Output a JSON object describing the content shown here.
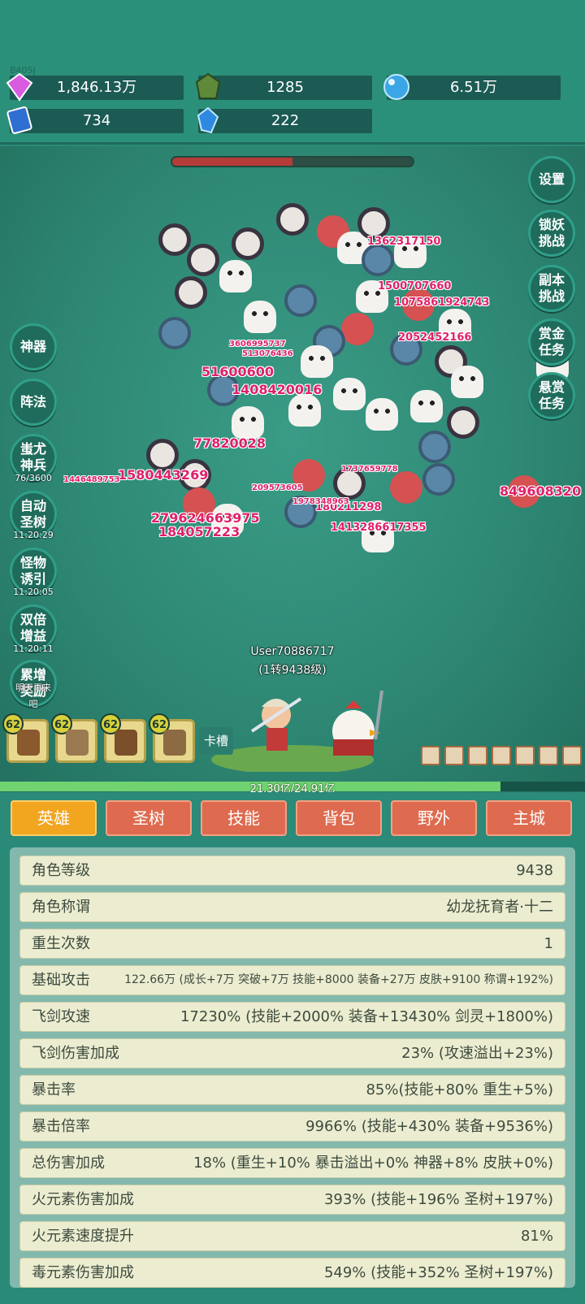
{
  "resources": {
    "partial_id": "B405J",
    "gem": "1,846.13万",
    "green_crystal": "1285",
    "blue_orb": "6.51万",
    "book": "734",
    "blue_crystal": "222"
  },
  "battle": {
    "boss_hp_fraction": 0.5,
    "left_buttons": [
      {
        "label": "神器",
        "timer": ""
      },
      {
        "label": "阵法",
        "timer": ""
      },
      {
        "label": "蚩尤\n神兵",
        "timer": "76/3600"
      },
      {
        "label": "自动\n圣树",
        "timer": "11:20:29"
      },
      {
        "label": "怪物\n诱引",
        "timer": "11:20:05"
      },
      {
        "label": "双倍\n增益",
        "timer": "11:20:11"
      },
      {
        "label": "累增\n奖励",
        "timer": "明天再来吧"
      }
    ],
    "right_buttons": [
      "设置",
      "锁妖\n挑战",
      "副本\n挑战",
      "赏金\n任务",
      "悬赏\n任务"
    ],
    "damage_numbers": [
      "1362317150",
      "1500707660",
      "1075861924743",
      "2052452166",
      "51600600",
      "1408420016",
      "77820028",
      "1580443269",
      "1446489753",
      "279624663975",
      "184057223",
      "180211298",
      "1413286617355",
      "849608320",
      "209573605",
      "1737659778",
      "1978348963",
      "3606995737",
      "513076436"
    ],
    "player_name": "User70886717",
    "player_level": "(1转9438级)",
    "equip_levels": [
      "62",
      "62",
      "62",
      "62"
    ],
    "card_slot": "卡槽",
    "xp_text": "21.30亿/24.91亿",
    "xp_fraction": 0.855
  },
  "tabs": [
    "英雄",
    "圣树",
    "技能",
    "背包",
    "野外",
    "主城"
  ],
  "active_tab": 0,
  "stats": [
    {
      "k": "角色等级",
      "v": "9438"
    },
    {
      "k": "角色称谓",
      "v": "幼龙抚育者·十二"
    },
    {
      "k": "重生次数",
      "v": "1"
    },
    {
      "k": "基础攻击",
      "v": "122.66万 (成长+7万 突破+7万 技能+8000 装备+27万 皮肤+9100 称谓+192%)"
    },
    {
      "k": "飞剑攻速",
      "v": "17230% (技能+2000% 装备+13430% 剑灵+1800%)"
    },
    {
      "k": "飞剑伤害加成",
      "v": "23% (攻速溢出+23%)"
    },
    {
      "k": "暴击率",
      "v": "85%(技能+80% 重生+5%)"
    },
    {
      "k": "暴击倍率",
      "v": "9966% (技能+430% 装备+9536%)"
    },
    {
      "k": "总伤害加成",
      "v": "18% (重生+10% 暴击溢出+0% 神器+8% 皮肤+0%)"
    },
    {
      "k": "火元素伤害加成",
      "v": "393% (技能+196% 圣树+197%)"
    },
    {
      "k": "火元素速度提升",
      "v": "81%"
    },
    {
      "k": "毒元素伤害加成",
      "v": "549% (技能+352% 圣树+197%)"
    }
  ],
  "colors": {
    "accent": "#f2a51f",
    "tab": "#de6b50",
    "panel": "#83b9ad",
    "row": "#ecedd0",
    "damage": "#e0206a"
  }
}
